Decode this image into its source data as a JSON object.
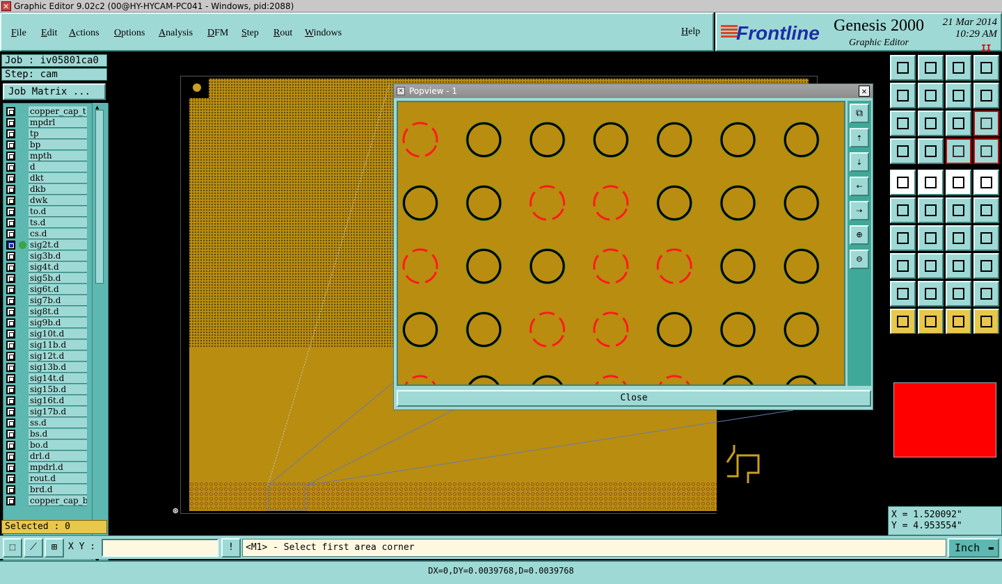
{
  "window": {
    "title": "Graphic Editor 9.02c2 (00@HY-HYCAM-PC041 - Windows, pid:2088)"
  },
  "menu": {
    "items": [
      {
        "label": "File",
        "name": "menu-file"
      },
      {
        "label": "Edit",
        "name": "menu-edit"
      },
      {
        "label": "Actions",
        "name": "menu-actions"
      },
      {
        "label": "Options",
        "name": "menu-options"
      },
      {
        "label": "Analysis",
        "name": "menu-analysis"
      },
      {
        "label": "DFM",
        "name": "menu-dfm"
      },
      {
        "label": "Step",
        "name": "menu-step"
      },
      {
        "label": "Rout",
        "name": "menu-rout"
      },
      {
        "label": "Windows",
        "name": "menu-windows"
      }
    ],
    "help": "Help"
  },
  "brand": {
    "logo": "Frontline",
    "product": "Genesis 2000",
    "subtitle": "Graphic Editor",
    "date": "21 Mar 2014",
    "time": "10:29 AM",
    "pause": "II"
  },
  "left": {
    "job": "Job : iv05801ca0",
    "step": "Step: cam",
    "job_matrix": "Job Matrix ...",
    "selected": "Selected : 0"
  },
  "layers": [
    {
      "name": "copper_cap_t"
    },
    {
      "name": "mpdrl"
    },
    {
      "name": "tp"
    },
    {
      "name": "bp"
    },
    {
      "name": "mpth"
    },
    {
      "name": "d"
    },
    {
      "name": "dkt"
    },
    {
      "name": "dkb"
    },
    {
      "name": "dwk"
    },
    {
      "name": "to.d"
    },
    {
      "name": "ts.d"
    },
    {
      "name": "cs.d"
    },
    {
      "name": "sig2t.d",
      "active": true
    },
    {
      "name": "sig3b.d"
    },
    {
      "name": "sig4t.d"
    },
    {
      "name": "sig5b.d"
    },
    {
      "name": "sig6t.d"
    },
    {
      "name": "sig7b.d"
    },
    {
      "name": "sig8t.d"
    },
    {
      "name": "sig9b.d"
    },
    {
      "name": "sig10t.d"
    },
    {
      "name": "sig11b.d"
    },
    {
      "name": "sig12t.d"
    },
    {
      "name": "sig13b.d"
    },
    {
      "name": "sig14t.d"
    },
    {
      "name": "sig15b.d"
    },
    {
      "name": "sig16t.d"
    },
    {
      "name": "sig17b.d"
    },
    {
      "name": "ss.d"
    },
    {
      "name": "bs.d"
    },
    {
      "name": "bo.d"
    },
    {
      "name": "drl.d"
    },
    {
      "name": "mpdrl.d"
    },
    {
      "name": "rout.d"
    },
    {
      "name": "brd.d"
    },
    {
      "name": "copper_cap_b"
    }
  ],
  "popview": {
    "title": "Popview - 1",
    "close_label": "Close",
    "pad_grid": [
      [
        "red",
        "black",
        "black",
        "black",
        "black",
        "black",
        "black"
      ],
      [
        "black",
        "black",
        "red",
        "red",
        "black",
        "black",
        "black"
      ],
      [
        "red",
        "black",
        "black",
        "red",
        "red",
        "black",
        "black"
      ],
      [
        "black",
        "black",
        "red",
        "red",
        "black",
        "black",
        "black"
      ],
      [
        "red",
        "black",
        "black",
        "red",
        "red",
        "black",
        "black"
      ]
    ],
    "colors": {
      "pad_ok": "#000000",
      "pad_error": "#ff1a1a",
      "pad_edge": "#2a8a2a",
      "copper": "#b88d10"
    }
  },
  "coords": {
    "x": "X = 1.520092\"",
    "y": "Y = 4.953554\""
  },
  "command": {
    "xy_label": "X Y :",
    "xy_value": "",
    "excl": "!",
    "message": "<M1> - Select first area corner",
    "unit": "Inch"
  },
  "status": {
    "text": "DX=0,DY=0.0039768,D=0.0039768"
  }
}
